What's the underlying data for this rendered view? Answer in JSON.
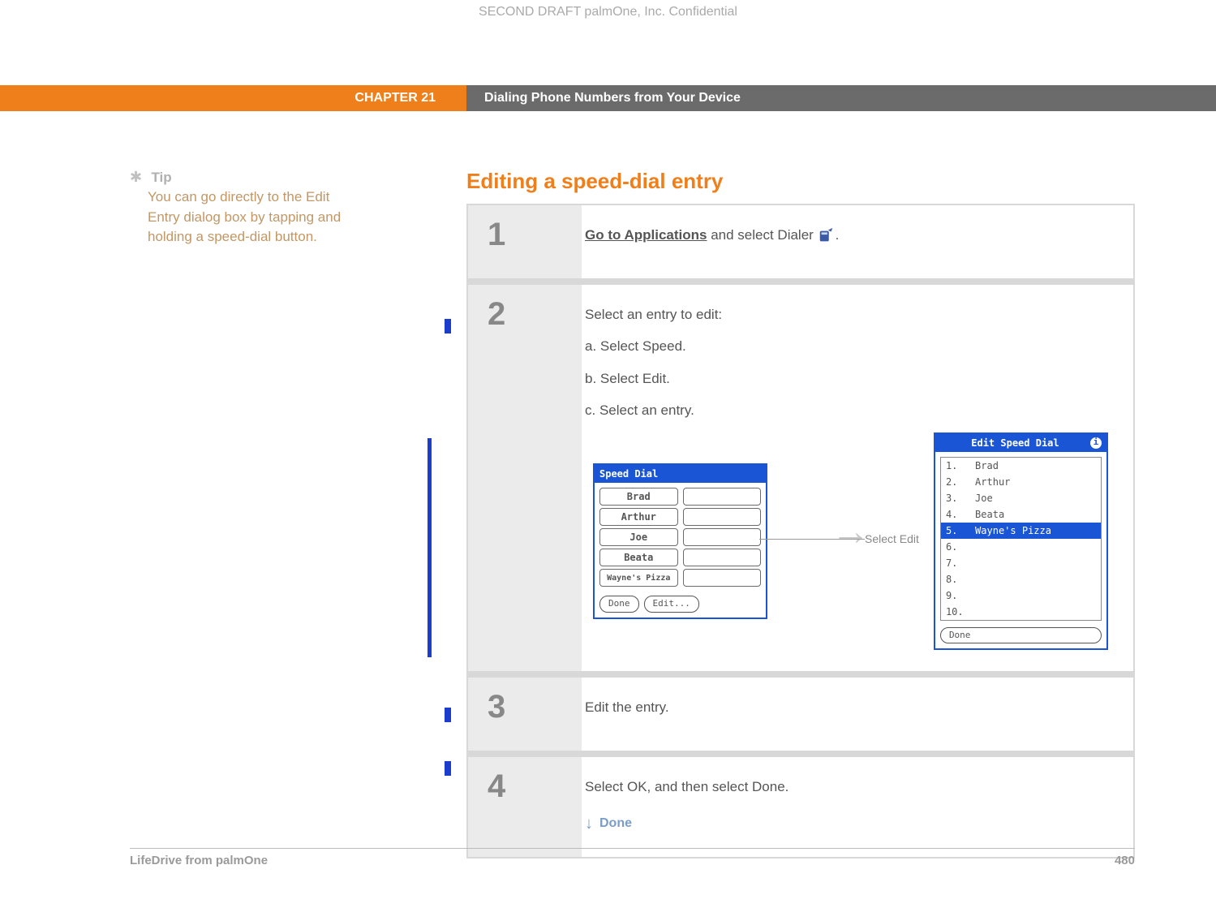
{
  "confidential": "SECOND DRAFT palmOne, Inc.  Confidential",
  "chapter": {
    "label": "CHAPTER 21",
    "title": "Dialing Phone Numbers from Your Device"
  },
  "tip": {
    "label": "Tip",
    "body": "You can go directly to the Edit Entry dialog box by tapping and holding a speed-dial button."
  },
  "section_title": "Editing a speed-dial entry",
  "steps": {
    "s1": {
      "num": "1",
      "link": "Go to Applications",
      "rest": " and select Dialer ",
      "tail": "."
    },
    "s2": {
      "num": "2",
      "intro": "Select an entry to edit:",
      "a": "a.  Select Speed.",
      "b": "b.  Select Edit.",
      "c": "c.  Select an entry.",
      "callout": "Select Edit"
    },
    "s3": {
      "num": "3",
      "text": "Edit the entry."
    },
    "s4": {
      "num": "4",
      "text": "Select OK, and then select Done.",
      "done": "Done"
    }
  },
  "speed_dial": {
    "title": "Speed Dial",
    "entries": [
      "Brad",
      "Arthur",
      "Joe",
      "Beata",
      "Wayne's Pizza"
    ],
    "done": "Done",
    "edit": "Edit..."
  },
  "edit_speed_dial": {
    "title": "Edit Speed Dial",
    "rows": [
      "1.   Brad",
      "2.   Arthur",
      "3.   Joe",
      "4.   Beata",
      "5.   Wayne's Pizza",
      "6.",
      "7.",
      "8.",
      "9.",
      "10."
    ],
    "selected_index": 4,
    "done": "Done"
  },
  "footer": {
    "product": "LifeDrive from palmOne",
    "page": "480"
  }
}
